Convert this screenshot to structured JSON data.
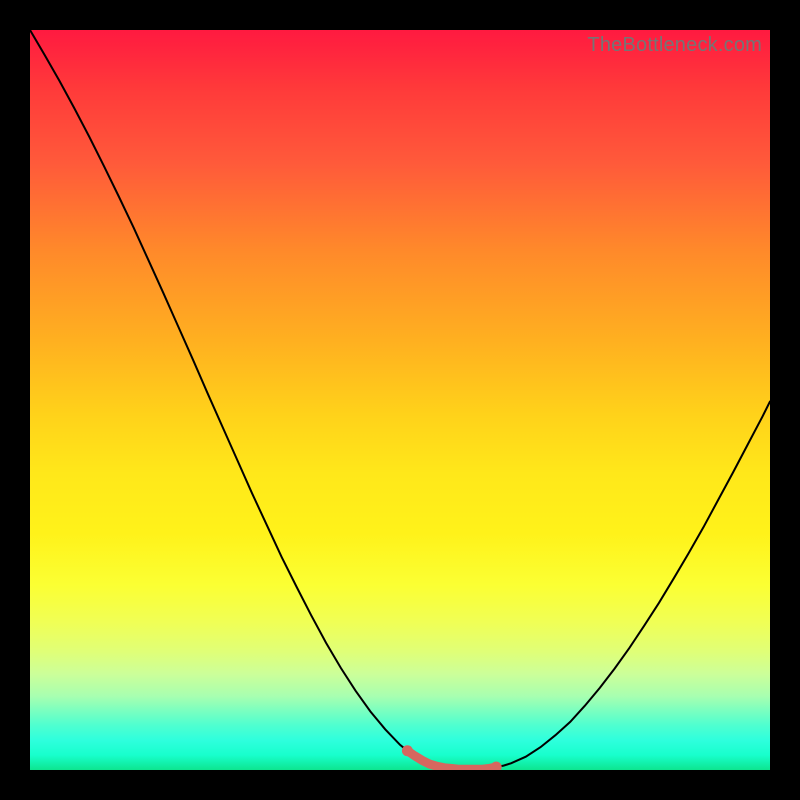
{
  "watermark": "TheBottleneck.com",
  "colors": {
    "frame": "#000000",
    "curve": "#000000",
    "highlight": "#d6675f",
    "gradient_top": "#ff1a40",
    "gradient_bottom": "#0de58f"
  },
  "chart_data": {
    "type": "line",
    "title": "",
    "xlabel": "",
    "ylabel": "",
    "xrange": [
      0,
      100
    ],
    "yrange": [
      0,
      100
    ],
    "x": [
      0,
      2,
      4,
      6,
      8,
      10,
      12,
      14,
      16,
      18,
      20,
      22,
      24,
      26,
      28,
      30,
      32,
      34,
      36,
      38,
      40,
      42,
      44,
      46,
      48,
      50,
      51,
      52,
      53,
      54,
      55,
      56,
      57,
      58,
      59,
      60,
      61,
      62,
      63,
      64,
      65,
      67,
      69,
      71,
      73,
      75,
      77,
      79,
      81,
      83,
      85,
      87,
      89,
      91,
      93,
      95,
      97,
      99,
      100
    ],
    "values": [
      100,
      96.6,
      93.1,
      89.4,
      85.6,
      81.6,
      77.5,
      73.3,
      68.9,
      64.5,
      60.0,
      55.5,
      50.9,
      46.4,
      41.9,
      37.4,
      33.1,
      28.8,
      24.8,
      20.9,
      17.2,
      13.8,
      10.7,
      7.9,
      5.5,
      3.4,
      2.6,
      1.9,
      1.3,
      0.8,
      0.5,
      0.3,
      0.2,
      0.1,
      0.1,
      0.1,
      0.1,
      0.2,
      0.4,
      0.6,
      0.9,
      1.8,
      3.1,
      4.7,
      6.5,
      8.7,
      11.1,
      13.7,
      16.5,
      19.5,
      22.6,
      25.9,
      29.3,
      32.8,
      36.5,
      40.2,
      44.0,
      47.8,
      49.8
    ],
    "highlight_range_x": [
      51,
      63
    ],
    "notes": "V-shaped bottleneck curve against vertical heat gradient. Highlighted segment near the minimum is drawn thicker in muted red. No axis ticks or labels visible."
  }
}
